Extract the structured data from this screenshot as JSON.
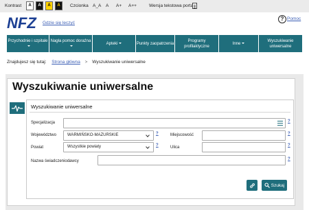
{
  "topbar": {
    "contrast_label": "Kontrast",
    "contrast_options": [
      "A",
      "A",
      "A",
      "A"
    ],
    "font_label": "Czcionka",
    "font_sizes": [
      "A_A",
      "A",
      "A+",
      "A++"
    ],
    "text_version_label": "Wersja tekstowa portalu"
  },
  "header": {
    "logo_text": "NFZ",
    "help_link": "Gdzie się leczyć",
    "pomoc_label": "Pomoc",
    "pomoc_icon_glyph": "?"
  },
  "nav": {
    "items": [
      {
        "label": "Przychodnie i szpitale",
        "dropdown": true
      },
      {
        "label": "Nagła pomoc doraźna",
        "dropdown": true
      },
      {
        "label": "Apteki",
        "dropdown": true
      },
      {
        "label": "Punkty zaopatrzenia",
        "dropdown": false
      },
      {
        "label": "Programy profilaktyczne",
        "dropdown": false
      },
      {
        "label": "Inne",
        "dropdown": true
      },
      {
        "label": "Wyszukiwanie uniwersalne",
        "dropdown": false
      }
    ]
  },
  "breadcrumb": {
    "prefix": "Znajdujesz się tutaj:",
    "home": "Strona główna",
    "separator": ">",
    "current": "Wyszukiwanie uniwersalne"
  },
  "page": {
    "title": "Wyszukiwanie uniwersalne"
  },
  "form": {
    "panel_title": "Wyszukiwanie uniwersalne",
    "info_glyph": "?",
    "specjalizacja": {
      "label": "Specjalizacja",
      "value": ""
    },
    "wojewodztwo": {
      "label": "Województwo",
      "value": "WARMIŃSKO-MAZURSKIE"
    },
    "powiat": {
      "label": "Powiat",
      "value": "Wszystkie powiaty"
    },
    "miejscowosc": {
      "label": "Miejscowość",
      "value": ""
    },
    "ulica": {
      "label": "Ulica",
      "value": ""
    },
    "nazwa": {
      "label": "Nazwa świadczeniodawcy",
      "value": ""
    },
    "search_button": "Szukaj"
  },
  "colors": {
    "brand_teal": "#1f6e7c",
    "logo_blue": "#1c3f93",
    "link_blue": "#3c5fb5",
    "page_gray": "#e9e9e9"
  }
}
